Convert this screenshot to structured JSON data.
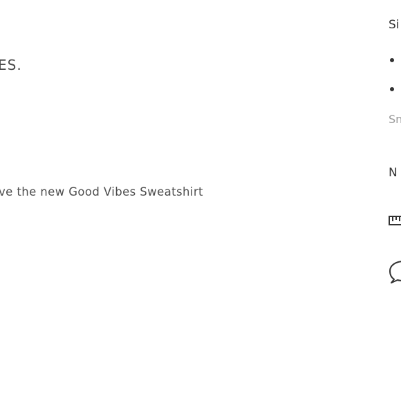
{
  "product": {
    "title_fragment": "ES.",
    "description_fragment": "ve the new Good Vibes Sweatshirt"
  },
  "sidebar": {
    "size_title_fragment": "Si",
    "size_options": [
      "",
      ""
    ],
    "size_guide_link_fragment": "Sn",
    "notes_title_fragment": "N",
    "icons": [
      "ruler-icon",
      "chat-icon"
    ]
  }
}
